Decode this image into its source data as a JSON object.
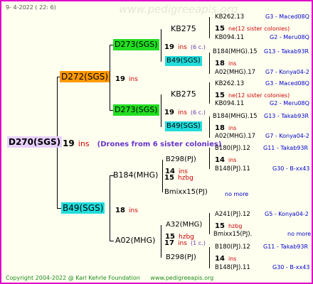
{
  "header": {
    "date": "9-  4-2022 ( 22:  6)",
    "watermark": "www.pedigreeapis.org"
  },
  "colors": {
    "border": "#e000c8",
    "green": "#22dd22",
    "cyan": "#22dddd",
    "orange": "#ff9900",
    "lavender": "#e8d0ff"
  },
  "root": {
    "id": "D270(SGS)",
    "gen": "19",
    "ins": "ins",
    "note": "(Drones from 6 sister colonies)"
  },
  "mother": {
    "id": "D272(SGS)",
    "gen": "19",
    "ins": "ins"
  },
  "father": {
    "id": "B49(SGS)",
    "gen": "18",
    "ins": "ins"
  },
  "mm": {
    "id": "D273(SGS)",
    "gen": "19",
    "ins": "ins",
    "paren": "(6 c.)"
  },
  "mf": {
    "id": "D273(SGS)",
    "gen": "19",
    "ins": "ins",
    "paren": "(6 c.)"
  },
  "fm": {
    "id": "B184(MHG)",
    "gen": "15",
    "ins": "hzbg"
  },
  "ff": {
    "id": "A02(MHG)",
    "gen": "17",
    "ins": "ins",
    "paren": "(1 c.)"
  },
  "mmm": {
    "id": "KB275"
  },
  "mmf": {
    "id": "B49(SGS)"
  },
  "mfm": {
    "id": "KB275"
  },
  "mff": {
    "id": "B49(SGS)"
  },
  "fmm": {
    "id": "B298(PJ)",
    "gen": "14",
    "ins": "ins"
  },
  "fmf": {
    "id": "Bmixx15(PJ)"
  },
  "ffm": {
    "id": "A32(MHG)",
    "gen": "15",
    "ins": "hzbg"
  },
  "ffp": {
    "id": "B298(PJ)",
    "gen": "14",
    "ins": "ins"
  },
  "g5": [
    {
      "a": "KB262.13",
      "b": "G3 - Maced08Q",
      "gen": "15",
      "mid": "ne",
      "midx": "(12 sister colonies)",
      "c": "KB094.11",
      "d": "G2 - Meru08Q"
    },
    {
      "a": "B184(MHG).15",
      "b": "G13 - Takab93R",
      "gen": "18",
      "mid": "ins",
      "midx": "",
      "c": "A02(MHG).17",
      "d": "G7 - Konya04-2"
    },
    {
      "a": "KB262.13",
      "b": "G3 - Maced08Q",
      "gen": "15",
      "mid": "ne",
      "midx": "(12 sister colonies)",
      "c": "KB094.11",
      "d": "G2 - Meru08Q"
    },
    {
      "a": "B184(MHG).15",
      "b": "G13 - Takab93R",
      "gen": "18",
      "mid": "ins",
      "midx": "",
      "c": "A02(MHG).17",
      "d": "G7 - Konya04-2"
    },
    {
      "a": "B180(PJ).12",
      "b": "G11 - Takab93R",
      "gen": "14",
      "mid": "ins",
      "midx": "",
      "c": "B148(PJ).11",
      "d": "G30 - B-xx43"
    },
    {
      "a": "",
      "b": "",
      "gen": "",
      "mid": "",
      "midx": "no more",
      "c": "",
      "d": ""
    },
    {
      "a": "A241(PJ).12",
      "b": "G5 - Konya04-2",
      "gen": "15",
      "mid": "hzbg",
      "midx": "",
      "c": "Bmixx15(PJ).",
      "d": "no more"
    },
    {
      "a": "B180(PJ).12",
      "b": "G11 - Takab93R",
      "gen": "14",
      "mid": "ins",
      "midx": "",
      "c": "B148(PJ).11",
      "d": "G30 - B-xx43"
    }
  ],
  "footer": {
    "copyright": "Copyright 2004-2022 @ Karl Kehrle Foundation",
    "site": "www.pedigreeapis.org"
  }
}
